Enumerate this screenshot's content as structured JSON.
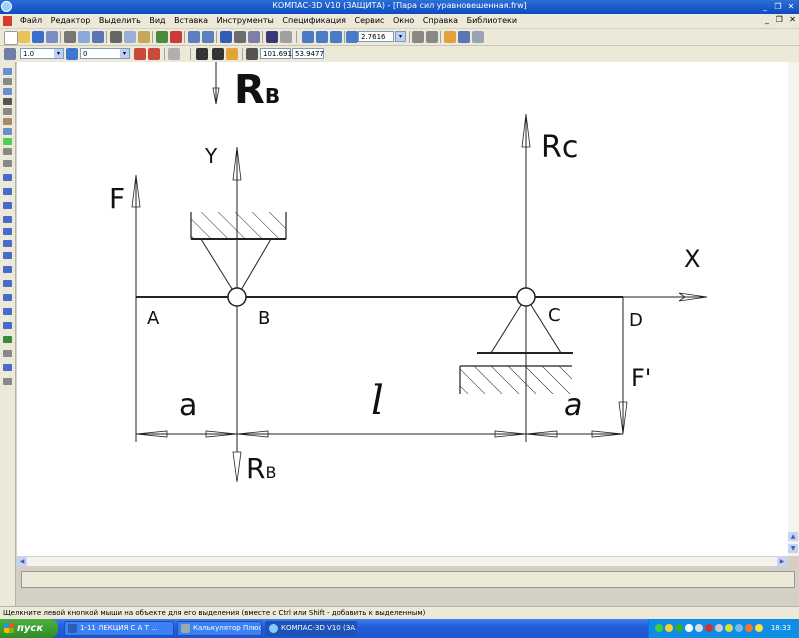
{
  "window": {
    "title": "КОМПАС-3D V10 (ЗАЩИТА) - [Пара сил уравновешенная.frw]",
    "buttons": [
      "_",
      "❐",
      "✕"
    ]
  },
  "menu": {
    "items": [
      "Файл",
      "Редактор",
      "Выделить",
      "Вид",
      "Вставка",
      "Инструменты",
      "Спецификация",
      "Сервис",
      "Окно",
      "Справка",
      "Библиотеки"
    ],
    "doc_buttons": [
      "_",
      "❐",
      "✕"
    ]
  },
  "toolbar": {
    "zoom_value": "2.7616",
    "line_width": "1.0",
    "layer": "0",
    "coord_x": "101.691",
    "coord_y": "53.9477"
  },
  "drawing": {
    "labels": {
      "rb_top": "R",
      "rb_top_sub": "B",
      "y": "Y",
      "f": "F",
      "rc": "Rc",
      "x": "X",
      "a_point": "A",
      "b_point": "B",
      "c_point": "C",
      "d_point": "D",
      "f_prime": "F'",
      "dim_a_left": "a",
      "dim_l": "l",
      "dim_a_right": "a",
      "rb_bottom": "R",
      "rb_bottom_sub": "B"
    }
  },
  "status_text": "Щелкните левой кнопкой мыши на объекте для его выделения (вместе с Ctrl или Shift - добавить к выделенным)",
  "taskbar": {
    "start": "пуск",
    "tasks": [
      "1-11 ЛЕКЦИЯ С А Т ...",
      "Калькулятор Плюс",
      "КОМПАС-3D V10 (ЗА..."
    ],
    "clock": "18:33"
  },
  "colors": {
    "titlebar": "#0b4ac2",
    "taskbar": "#245edb",
    "start_button": "#2e8b25",
    "canvas": "#ffffff"
  }
}
